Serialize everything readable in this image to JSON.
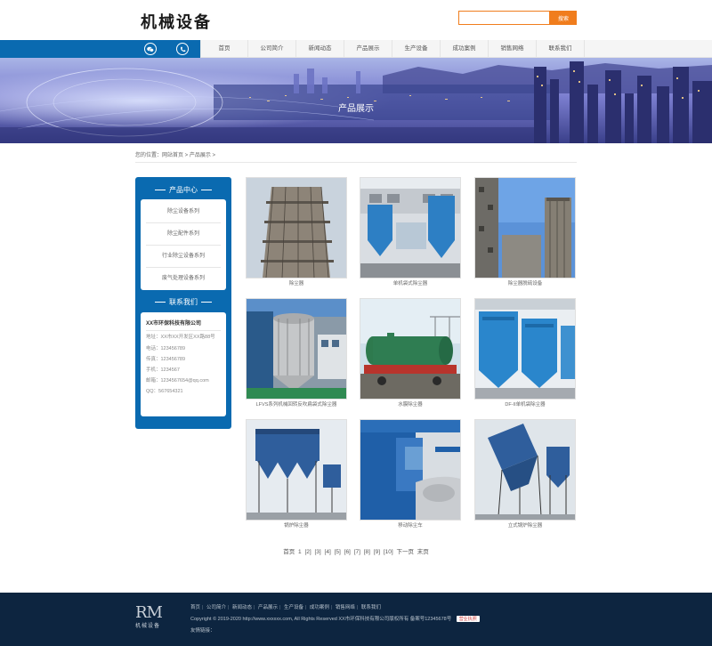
{
  "header": {
    "logo": "机械设备",
    "search": {
      "placeholder": "",
      "button": "搜索"
    }
  },
  "nav": {
    "icons": [
      "wechat-icon",
      "phone-icon"
    ],
    "items": [
      "首页",
      "公司简介",
      "新闻动态",
      "产品展示",
      "生产设备",
      "成功案例",
      "销售网络",
      "联系我们"
    ]
  },
  "banner": {
    "title": "产品展示"
  },
  "breadcrumb": {
    "text": "您的位置：网站首页 > 产品展示 >"
  },
  "sidebar": {
    "category_title": "产品中心",
    "categories": [
      "除尘设备系列",
      "除尘配件系列",
      "行业除尘设备系列",
      "废气处理设备系列"
    ],
    "contact_title": "联系我们",
    "contact": {
      "company": "XX市环保科技有限公司",
      "address": "地址：XX市XX开发区XX路88号",
      "phone": "电话：123456789",
      "fax": "传真：123456789",
      "mobile": "手机：1234567",
      "email": "邮箱：1234567654@qq.com",
      "qq": "QQ：567654321"
    }
  },
  "products": [
    {
      "caption": "除尘器"
    },
    {
      "caption": "单机袋式除尘器"
    },
    {
      "caption": "除尘器脱硫设备"
    },
    {
      "caption": "LFVS系列机械回转反吹扁袋式除尘器"
    },
    {
      "caption": "水膜除尘器"
    },
    {
      "caption": "DF-II单机袋除尘器"
    },
    {
      "caption": "锅炉除尘器"
    },
    {
      "caption": "移动除尘车"
    },
    {
      "caption": "立式锅炉除尘器"
    }
  ],
  "pagination": {
    "first": "首页",
    "current": "1",
    "pages": [
      "[2]",
      "[3]",
      "[4]",
      "[5]",
      "[6]",
      "[7]",
      "[8]",
      "[9]",
      "[10]"
    ],
    "next": "下一页",
    "last": "末页"
  },
  "footer": {
    "logo_mark": "RM",
    "logo_text": "机械设备",
    "links": [
      "首页",
      "公司简介",
      "新闻动态",
      "产品展示",
      "生产设备",
      "成功案例",
      "销售网络",
      "联系我们"
    ],
    "copyright": "Copyright © 2019-2020 http://www.xxxxxx.com, All Rights Reserved XX市环保科技有限公司版权所有 备案号12345678号",
    "badge": "营业执照",
    "friend_links": "友情链接："
  },
  "colors": {
    "primary": "#0a6ab0",
    "accent": "#f07d1d",
    "footer": "#0d2540"
  }
}
